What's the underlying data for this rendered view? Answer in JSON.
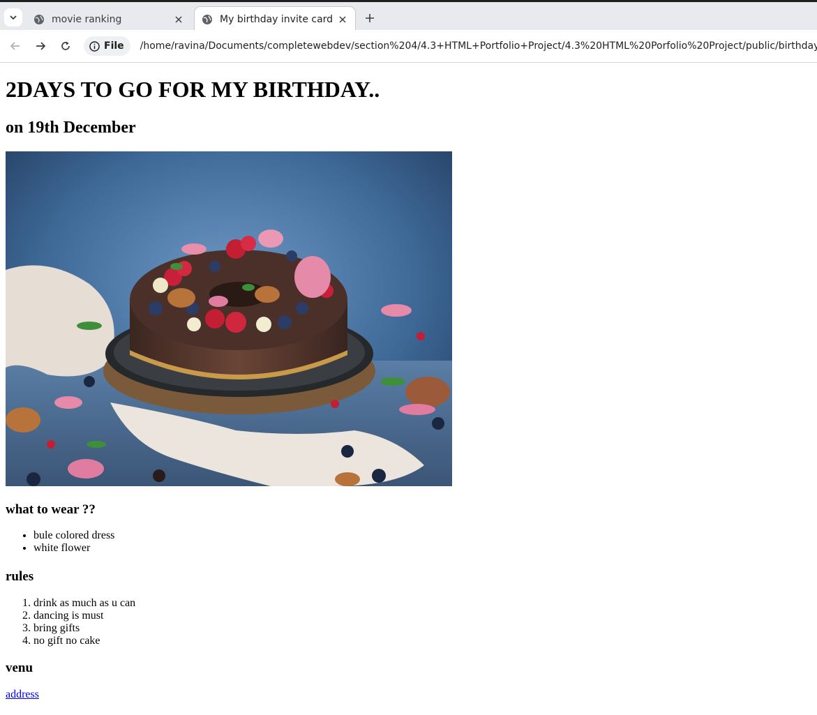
{
  "browser": {
    "tabs": [
      {
        "title": "movie ranking",
        "active": false
      },
      {
        "title": "My birthday invite card",
        "active": true
      }
    ],
    "address_chip": "File",
    "url": "/home/ravina/Documents/completewebdev/section%204/4.3+HTML+Portfolio+Project/4.3%20HTML%20Porfolio%20Project/public/birthdayinvite.html"
  },
  "page": {
    "heading": "2DAYS TO GO FOR MY BIRTHDAY..",
    "subheading": "on 19th December",
    "wear": {
      "title": "what to wear ??",
      "items": [
        "bule colored dress",
        "white flower"
      ]
    },
    "rules": {
      "title": "rules",
      "items": [
        "drink as much as u can",
        "dancing is must",
        "bring gifts",
        "no gift no cake"
      ]
    },
    "venue": {
      "title": "venu",
      "link": "address"
    }
  },
  "colors": {
    "link": "#0000ee",
    "tab_bar": "#e8eaed",
    "background": "#ffffff"
  }
}
